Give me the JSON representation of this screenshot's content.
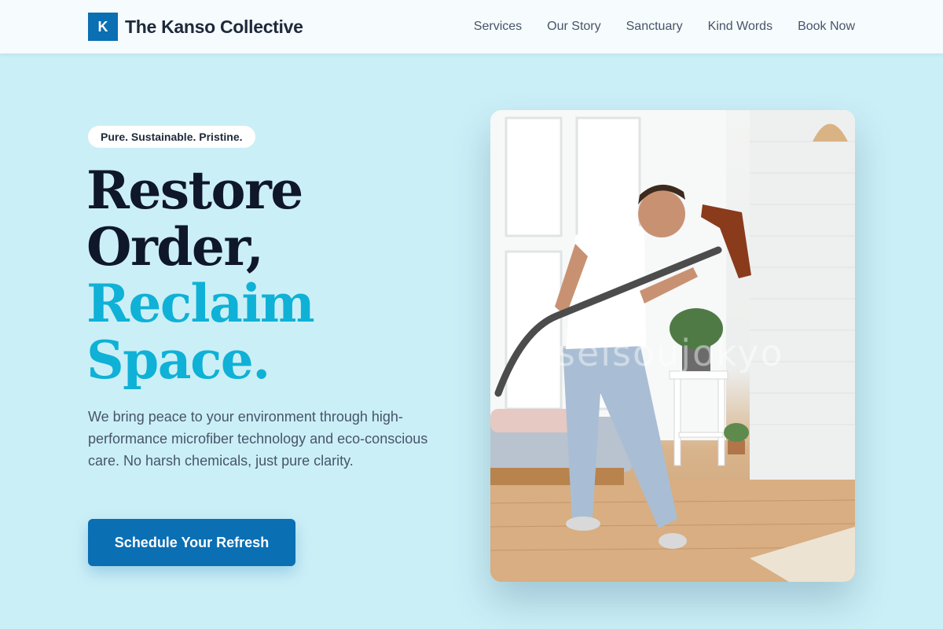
{
  "header": {
    "logo_letter": "K",
    "brand_name": "The Kanso Collective",
    "nav": [
      {
        "label": "Services"
      },
      {
        "label": "Our Story"
      },
      {
        "label": "Sanctuary"
      },
      {
        "label": "Kind Words"
      },
      {
        "label": "Book Now"
      }
    ]
  },
  "hero": {
    "tagline": "Pure. Sustainable. Pristine.",
    "headline_line1": "Restore",
    "headline_line2": "Order,",
    "headline_line3": "Reclaim",
    "headline_line4": "Space.",
    "description": "We bring peace to your environment through high-performance microfiber technology and eco-conscious care. No harsh chemicals, just pure clarity.",
    "cta_label": "Schedule Your Refresh",
    "image_watermark": "seisoujokyo"
  },
  "colors": {
    "background": "#cbeff7",
    "brand_blue": "#0a6fb3",
    "accent_cyan": "#0fb1d6",
    "heading_dark": "#0f172a",
    "body_text": "#475569"
  }
}
